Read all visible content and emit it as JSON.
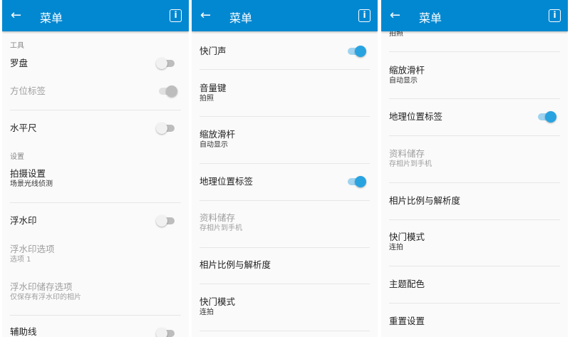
{
  "header": {
    "title": "菜单",
    "back_icon": "arrow-left-icon",
    "info_icon": "info-icon",
    "color": "#0288d1"
  },
  "panel1": {
    "cat_tools": "工具",
    "compass": "罗盘",
    "bearing_label": "方位标签",
    "level": "水平尺",
    "cat_settings": "设置",
    "shoot_settings": "拍摄设置",
    "shoot_settings_sub": "场景光线侦测",
    "watermark": "浮水印",
    "watermark_opts": "浮水印选项",
    "watermark_opts_sub": "选项 1",
    "watermark_save": "浮水印储存选项",
    "watermark_save_sub": "仅保存有浮水印的相片",
    "gridlines": "辅助线"
  },
  "panel2": {
    "shutter_sound": "快门声",
    "volume_key": "音量键",
    "volume_key_sub": "拍照",
    "zoom_slider": "缩放滑杆",
    "zoom_slider_sub": "自动显示",
    "geotag": "地理位置标签",
    "storage": "资料储存",
    "storage_sub": "存相片到手机",
    "ratio": "相片比例与解析度",
    "shutter_mode": "快门模式",
    "shutter_mode_sub": "连拍"
  },
  "panel3": {
    "top_sub": "拍照",
    "zoom_slider": "缩放滑杆",
    "zoom_slider_sub": "自动显示",
    "geotag": "地理位置标签",
    "storage": "资料储存",
    "storage_sub": "存相片到手机",
    "ratio": "相片比例与解析度",
    "shutter_mode": "快门模式",
    "shutter_mode_sub": "连拍",
    "theme": "主题配色",
    "reset": "重置设置"
  },
  "toggles": {
    "compass": false,
    "bearing_label": true,
    "level": false,
    "watermark": false,
    "gridlines": false,
    "shutter_sound": true,
    "geotag": true
  }
}
